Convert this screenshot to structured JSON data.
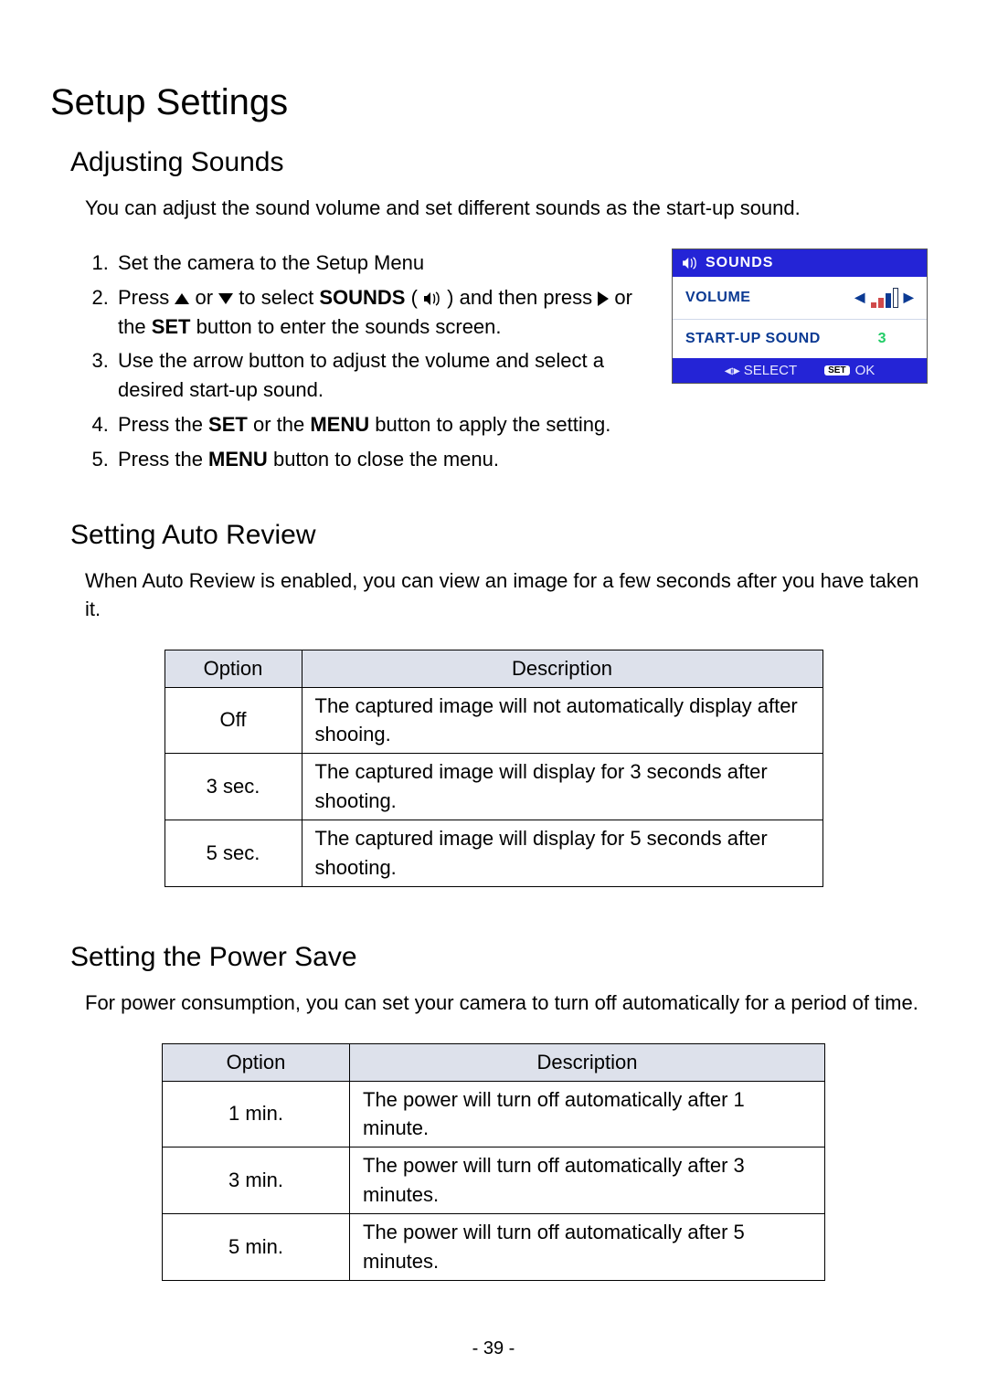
{
  "page": {
    "number": "- 39 -"
  },
  "h1": "Setup Settings",
  "sounds": {
    "heading": "Adjusting Sounds",
    "intro": "You can adjust the sound volume and set different sounds as the start-up sound.",
    "steps": {
      "s1": "Set the camera to the Setup Menu",
      "s2a": "Press ",
      "s2b": " or ",
      "s2c": " to select ",
      "s2_sounds": "SOUNDS",
      "s2d": " (",
      "s2e": ") and then press ",
      "s2f": " or the ",
      "s2_set": "SET",
      "s2g": " button to enter the sounds screen.",
      "s3": "Use the arrow button to adjust the volume and select a desired start-up sound.",
      "s4a": "Press the ",
      "s4_set": "SET",
      "s4b": " or the ",
      "s4_menu": "MENU",
      "s4c": " button to apply the setting.",
      "s5a": "Press the ",
      "s5_menu": "MENU",
      "s5b": " button to close the menu."
    },
    "lcd": {
      "title": "SOUNDS",
      "row_volume": "VOLUME",
      "row_startup": "START-UP SOUND",
      "startup_value": "3",
      "footer_select": "SELECT",
      "footer_set": "SET",
      "footer_ok": "OK"
    }
  },
  "autoreview": {
    "heading": "Setting Auto Review",
    "intro": "When Auto Review is enabled, you can view an image for a few seconds after you have taken it.",
    "table": {
      "h_option": "Option",
      "h_desc": "Description",
      "rows": [
        {
          "option": "Off",
          "desc": "The captured image will not automatically display after shooing."
        },
        {
          "option": "3 sec.",
          "desc": "The captured image will display for 3 seconds after shooting."
        },
        {
          "option": "5 sec.",
          "desc": "The captured image will display for 5 seconds after shooting."
        }
      ]
    }
  },
  "powersave": {
    "heading": "Setting the Power Save",
    "intro": "For power consumption, you can set your camera to turn off automatically for a period of time.",
    "table": {
      "h_option": "Option",
      "h_desc": "Description",
      "rows": [
        {
          "option": "1 min.",
          "desc": "The power will turn off automatically after 1 minute."
        },
        {
          "option": "3 min.",
          "desc": "The power will turn off automatically after 3 minutes."
        },
        {
          "option": "5 min.",
          "desc": "The power will turn off automatically after 5 minutes."
        }
      ]
    }
  }
}
